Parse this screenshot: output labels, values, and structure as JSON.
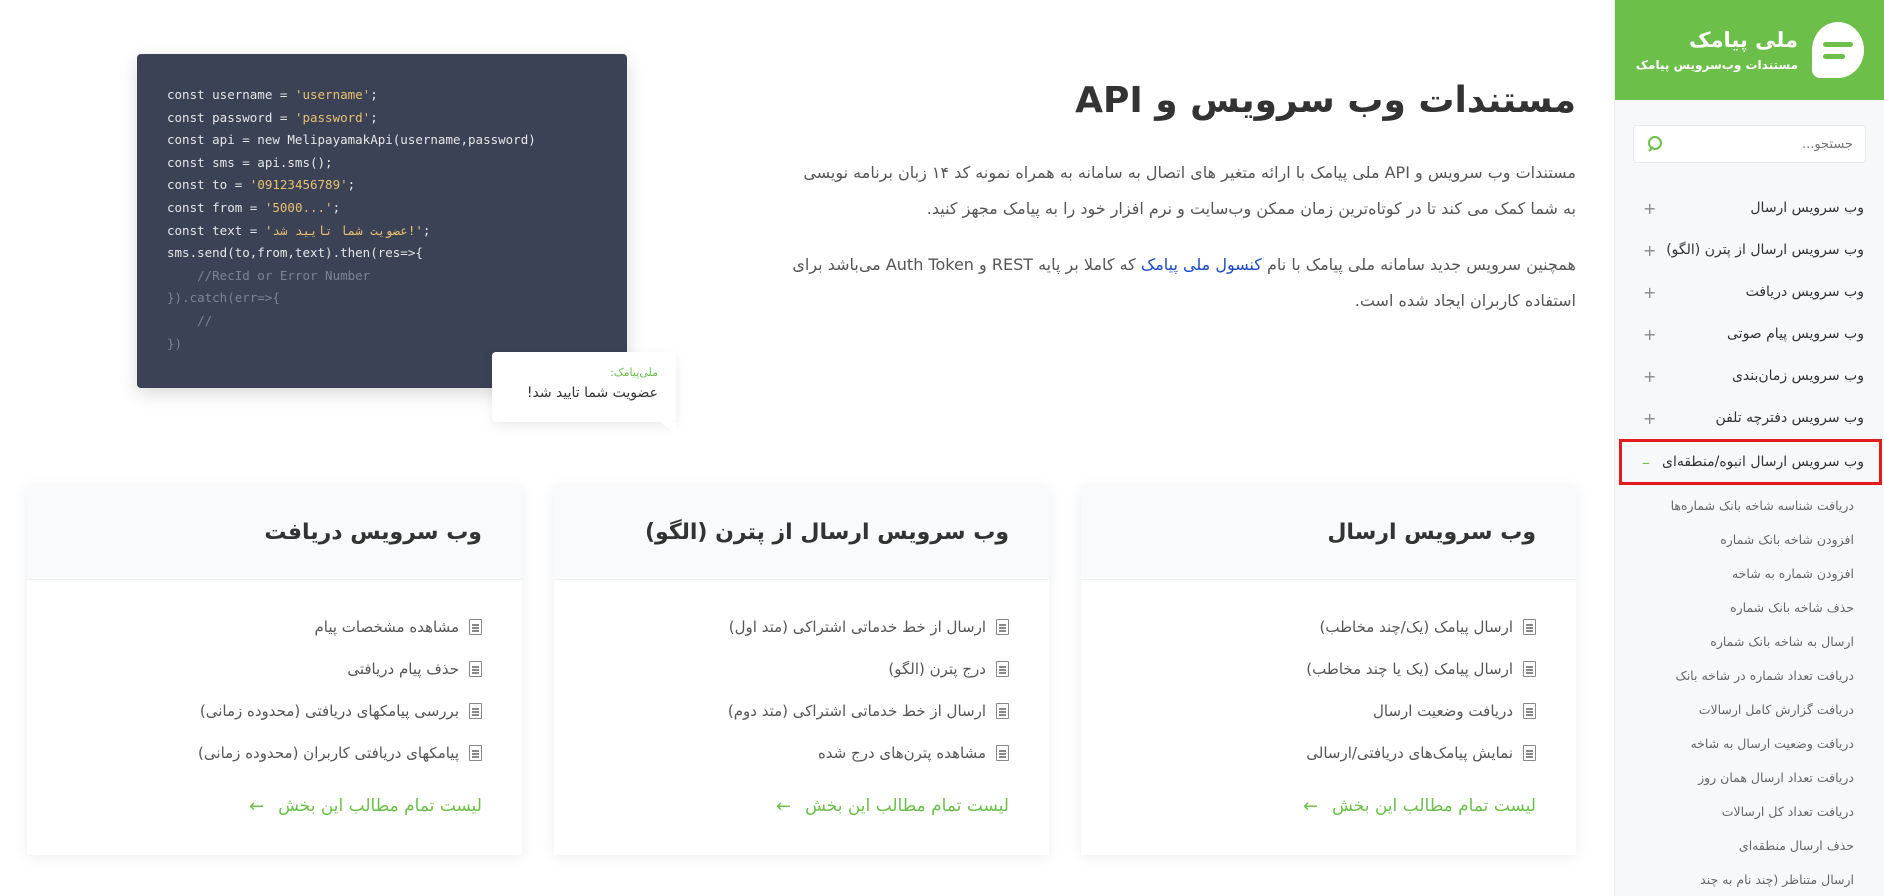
{
  "brand": {
    "title": "ملی پیامک",
    "subtitle": "مستندات وب‌سرویس پیامک",
    "logo_icon": "chat-bubble-icon",
    "color": "#6cc04a"
  },
  "search": {
    "placeholder": "جستجو..."
  },
  "sidebar": {
    "items": [
      {
        "label": "وب سرویس ارسال",
        "toggle": "+"
      },
      {
        "label": "وب سرویس ارسال از پترن (الگو)",
        "toggle": "+"
      },
      {
        "label": "وب سرویس دریافت",
        "toggle": "+"
      },
      {
        "label": "وب سرویس پیام صوتی",
        "toggle": "+"
      },
      {
        "label": "وب سرویس زمان‌بندی",
        "toggle": "+"
      },
      {
        "label": "وب سرویس دفترچه تلفن",
        "toggle": "+"
      },
      {
        "label": "وب سرویس ارسال انبوه/منطقه‌ای",
        "toggle": "–"
      }
    ],
    "subitems": [
      "دریافت شناسه شاخه بانک شماره‌ها",
      "افزودن شاخه بانک شماره",
      "افزودن شماره به شاخه",
      "حذف شاخه بانک شماره",
      "ارسال به شاخه بانک شماره",
      "دریافت تعداد شماره در شاخه بانک",
      "دریافت گزارش کامل ارسالات",
      "دریافت وضعیت ارسال به شاخه",
      "دریافت تعداد ارسال همان روز",
      "دریافت تعداد کل ارسالات",
      "حذف ارسال منطقه‌ای",
      "ارسال متناظر (چند نام به چند"
    ]
  },
  "hero": {
    "title": "مستندات وب سرویس و API",
    "paragraph1": "مستندات وب سرویس و API ملی پیامک با ارائه متغیر های اتصال به سامانه به همراه نمونه کد ۱۴ زبان برنامه نویسی به شما کمک می کند تا در کوتاه‌ترین زمان ممکن وب‌سایت و نرم افزار خود را به پیامک مجهز کنید.",
    "paragraph2_before": "همچنین سرویس جدید سامانه ملی پیامک با نام",
    "paragraph2_link": "کنسول ملی پیامک",
    "paragraph2_after": "که کاملا بر پایه REST و Auth Token می‌باشد برای استفاده کاربران ایجاد شده است."
  },
  "code": {
    "l1_a": "const username = ",
    "l1_s": "'username'",
    "l1_b": ";",
    "l2_a": "const password = ",
    "l2_s": "'password'",
    "l2_b": ";",
    "l3": "const api = new MelipayamakApi(username,password)",
    "l4": "const sms = api.sms();",
    "l5_a": "const to = ",
    "l5_s": "'09123456789'",
    "l5_b": ";",
    "l6_a": "const from = ",
    "l6_s": "'5000...'",
    "l6_b": ";",
    "l7_a": "const text = ",
    "l7_s": "'عضویت شما تایید شد!'",
    "l7_b": ";",
    "l8": "sms.send(to,from,text).then(res=>{",
    "l9": "    //RecId or Error Number",
    "l10": "}).catch(err=>{",
    "l11": "    //",
    "l12": "})"
  },
  "bubble": {
    "sender": "ملی‌پیامک:",
    "text": "عضویت شما تایید شد!"
  },
  "cards": [
    {
      "title": "وب سرویس ارسال",
      "items": [
        "ارسال پیامک (یک/چند مخاطب)",
        "ارسال پیامک (یک یا چند مخاطب)",
        "دریافت وضعیت ارسال",
        "نمایش پیامک‌های دریافتی/ارسالی"
      ],
      "link": "لیست تمام مطالب این بخش"
    },
    {
      "title": "وب سرویس ارسال از پترن (الگو)",
      "items": [
        "ارسال از خط خدماتی اشتراکی (متد اول)",
        "درج پترن (الگو)",
        "ارسال از خط خدماتی اشتراکی (متد دوم)",
        "مشاهده پترن‌های درج شده"
      ],
      "link": "لیست تمام مطالب این بخش"
    },
    {
      "title": "وب سرویس دریافت",
      "items": [
        "مشاهده مشخصات پیام",
        "حذف پیام دریافتی",
        "بررسی پیامکهای دریافتی (محدوده زمانی)",
        "پیامکهای دریافتی کاربران (محدوده زمانی)"
      ],
      "link": "لیست تمام مطالب این بخش"
    }
  ]
}
